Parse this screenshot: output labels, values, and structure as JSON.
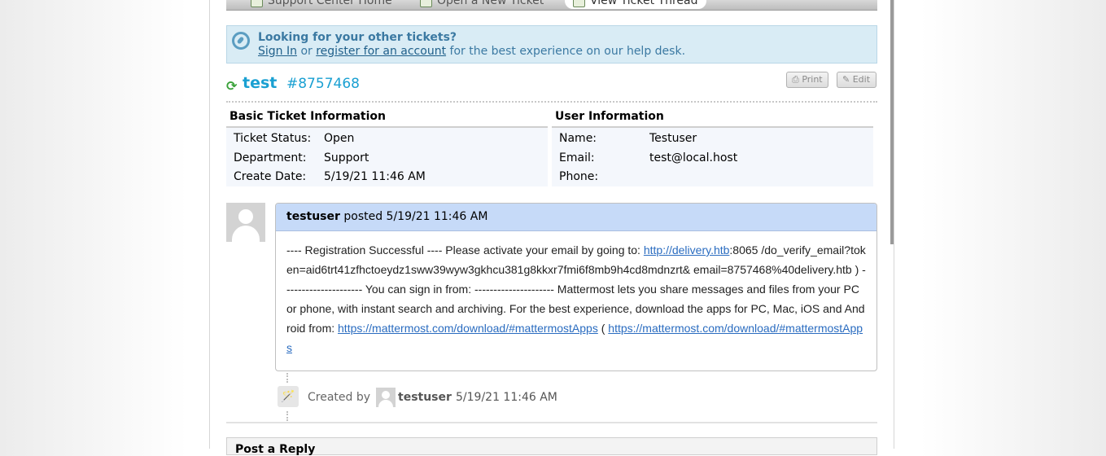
{
  "nav": {
    "items": [
      {
        "label": "Support Center Home",
        "icon": "home-icon"
      },
      {
        "label": "Open a New Ticket",
        "icon": "new-ticket-icon"
      },
      {
        "label": "View Ticket Thread",
        "icon": "ticket-thread-icon"
      }
    ]
  },
  "notice": {
    "title": "Looking for your other tickets?",
    "sign_in": "Sign In",
    "or": " or ",
    "register": "register for an account",
    "suffix": " for the best experience on our help desk."
  },
  "ticket": {
    "subject": "test",
    "number": "#8757468",
    "print_label": "Print",
    "edit_label": "Edit"
  },
  "basic_info": {
    "heading": "Basic Ticket Information",
    "rows": [
      {
        "label": "Ticket Status:",
        "value": "Open"
      },
      {
        "label": "Department:",
        "value": "Support"
      },
      {
        "label": "Create Date:",
        "value": "5/19/21 11:46 AM"
      }
    ]
  },
  "user_info": {
    "heading": "User Information",
    "rows": [
      {
        "label": "Name:",
        "value": "Testuser"
      },
      {
        "label": "Email:",
        "value": "test@local.host"
      },
      {
        "label": "Phone:",
        "value": ""
      }
    ]
  },
  "thread_entry": {
    "author": "testuser",
    "posted": " posted 5/19/21 11:46 AM",
    "body_pre": "---- Registration Successful ---- Please activate your email by going to: ",
    "link1": "http://delivery.htb",
    "body_mid": ":8065 /do_verify_email?token=aid6trt41zfhctoeydz1sww39wyw3gkhcu381g8kkxr7fmi6f8mb9h4cd8mdnzrt& email=8757468%40delivery.htb ) --------------------- You can sign in from: --------------------- Mattermost lets you share messages and files from your PC or phone, with instant search and archiving. For the best experience, download the apps for PC, Mac, iOS and Android from: ",
    "link2": "https://mattermost.com/download/#mattermostApps",
    "body_paren": " ( ",
    "link3": "https://mattermost.com/download/#mattermostApps"
  },
  "event": {
    "prefix": "Created by",
    "user": "testuser",
    "date": "5/19/21 11:46 AM"
  },
  "reply": {
    "heading": "Post a Reply"
  }
}
